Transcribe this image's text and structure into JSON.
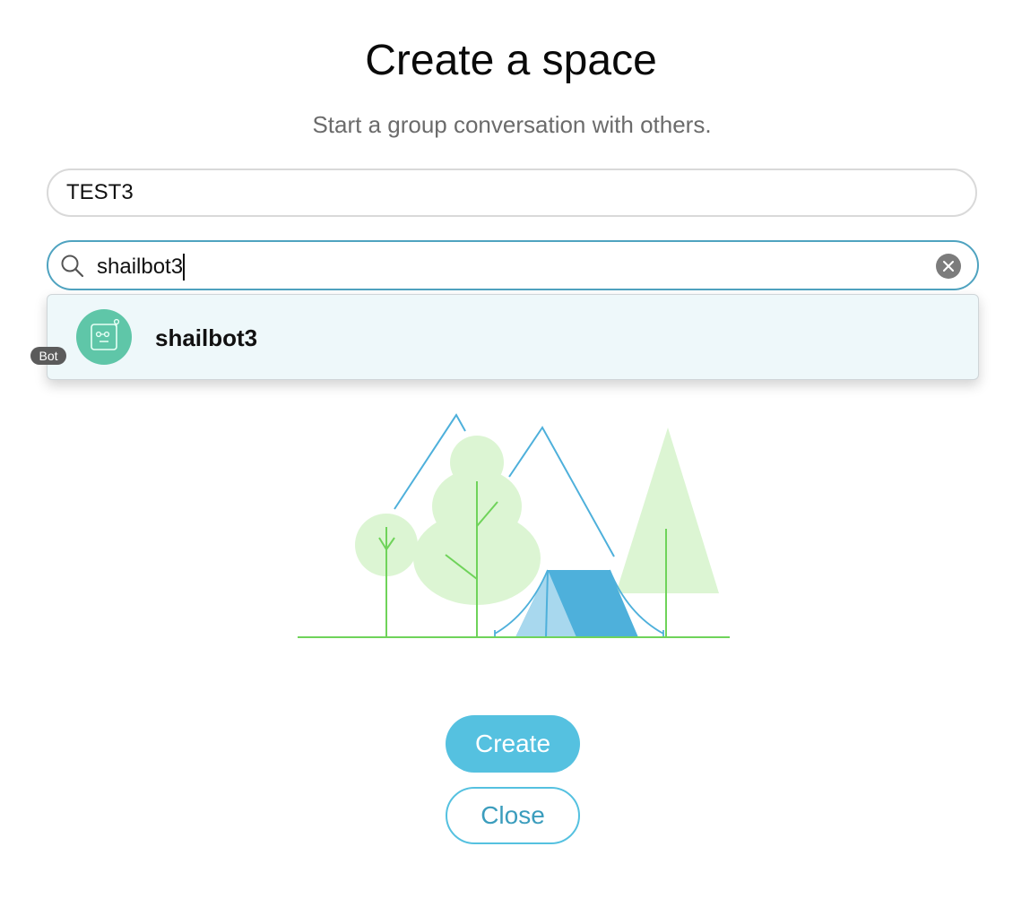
{
  "dialog": {
    "title": "Create a space",
    "subtitle": "Start a group conversation with others."
  },
  "space_name_input": {
    "value": "TEST3"
  },
  "search_input": {
    "value": "shailbot3"
  },
  "search_results": [
    {
      "name": "shailbot3",
      "badge": "Bot",
      "avatar_color": "#5fc6a8"
    }
  ],
  "buttons": {
    "create_label": "Create",
    "close_label": "Close"
  },
  "colors": {
    "accent": "#55c1e0",
    "focus_border": "#4fa3c0",
    "result_highlight": "#eef8fa",
    "illustration_green": "#dcf5d3",
    "illustration_line_green": "#6fd35a",
    "illustration_blue": "#4eb0db"
  },
  "icons": {
    "search": "search-icon",
    "clear": "clear-icon",
    "avatar": "bot-avatar-icon"
  }
}
